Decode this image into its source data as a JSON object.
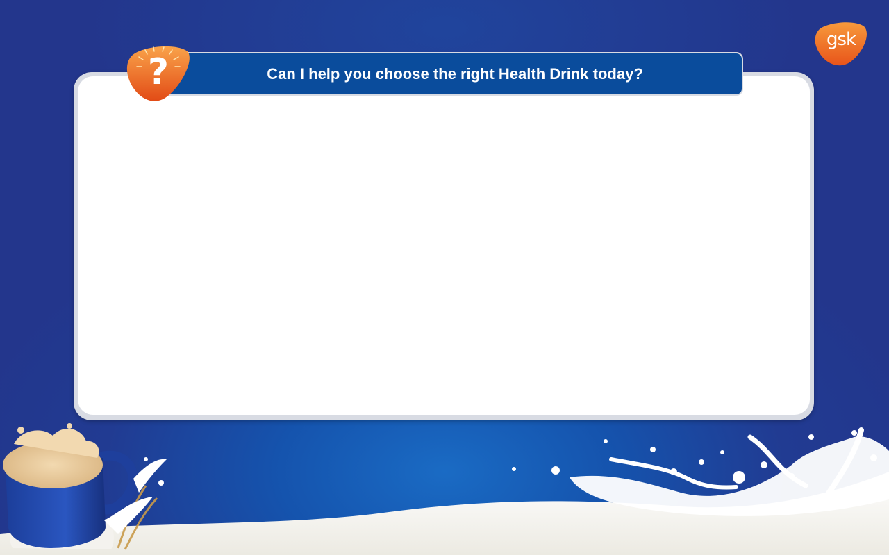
{
  "header": {
    "title": "Can I help you choose the right Health Drink today?",
    "help_icon": "question-mark-icon"
  },
  "brand": {
    "logo_text": "gsk",
    "logo_icon": "gsk-logo",
    "accent_orange": "#f26a21",
    "primary_blue": "#0a4c9c",
    "background_blue": "#23368c"
  },
  "panel": {
    "content": ""
  },
  "decor": {
    "milk_splash": "milk-splash-image",
    "cup": "health-drink-cup-image"
  }
}
